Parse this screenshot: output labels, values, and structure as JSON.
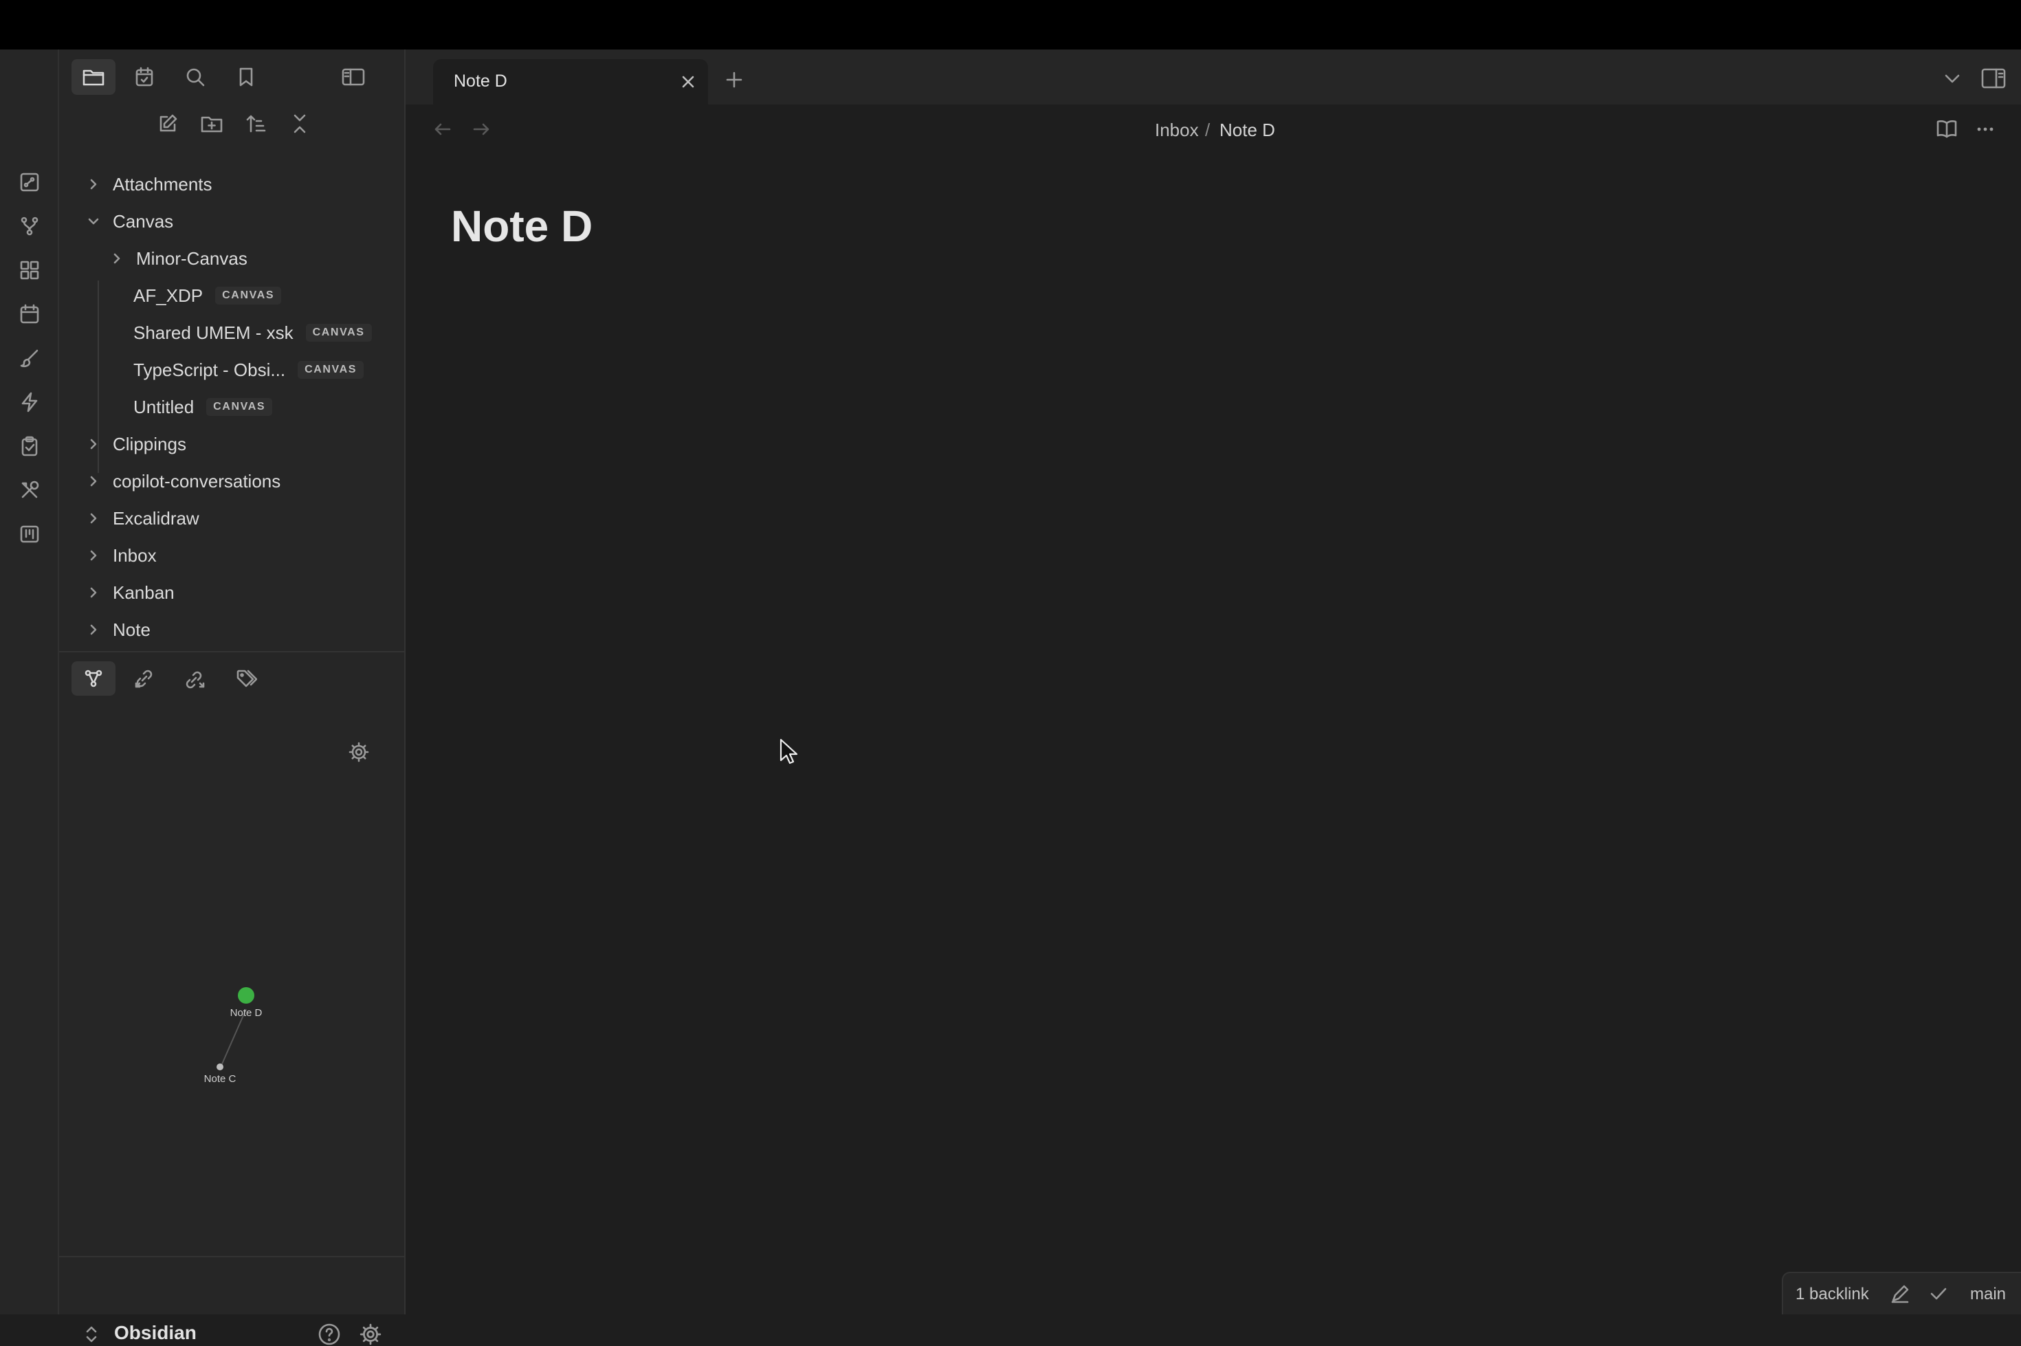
{
  "app": {
    "vault_name": "Obsidian"
  },
  "tabs": [
    {
      "title": "Note D",
      "active": true
    }
  ],
  "breadcrumb": {
    "folder": "Inbox",
    "separator": "/",
    "note": "Note D"
  },
  "note": {
    "title": "Note D"
  },
  "file_tree": [
    {
      "label": "Attachments",
      "type": "folder",
      "expanded": false
    },
    {
      "label": "Canvas",
      "type": "folder",
      "expanded": true
    },
    {
      "label": "Minor-Canvas",
      "type": "folder",
      "expanded": false,
      "depth": 1
    },
    {
      "label": "AF_XDP",
      "type": "canvas",
      "badge": "CANVAS",
      "depth": 1
    },
    {
      "label": "Shared UMEM - xsk",
      "type": "canvas",
      "badge": "CANVAS",
      "depth": 1
    },
    {
      "label": "TypeScript - Obsi...",
      "type": "canvas",
      "badge": "CANVAS",
      "depth": 1
    },
    {
      "label": "Untitled",
      "type": "canvas",
      "badge": "CANVAS",
      "depth": 1
    },
    {
      "label": "Clippings",
      "type": "folder",
      "expanded": false
    },
    {
      "label": "copilot-conversations",
      "type": "folder",
      "expanded": false
    },
    {
      "label": "Excalidraw",
      "type": "folder",
      "expanded": false
    },
    {
      "label": "Inbox",
      "type": "folder",
      "expanded": false
    },
    {
      "label": "Kanban",
      "type": "folder",
      "expanded": false
    },
    {
      "label": "Note",
      "type": "folder",
      "expanded": false
    }
  ],
  "local_graph": {
    "nodes": [
      {
        "label": "Note D",
        "current": true
      },
      {
        "label": "Note C",
        "current": false
      }
    ]
  },
  "status_bar": {
    "backlinks": "1 backlink",
    "branch": "main"
  },
  "colors": {
    "background": "#1e1e1e",
    "sidebar": "#262626",
    "active_node": "#3cb043"
  }
}
